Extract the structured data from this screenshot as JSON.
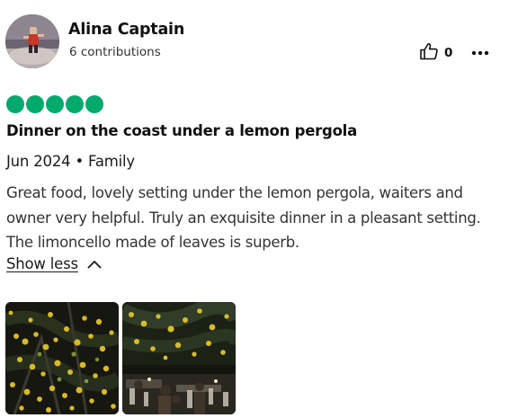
{
  "reviewer": {
    "name": "Alina Captain",
    "contributions": "6 contributions",
    "avatar_icon": "profile-photo-avatar"
  },
  "actions": {
    "helpful_icon": "thumbs-up-icon",
    "helpful_count": "0",
    "more_icon": "more-options-icon"
  },
  "rating": {
    "bubbles_filled": 5,
    "bubbles_total": 5,
    "color": "#00aa6c"
  },
  "review": {
    "title": "Dinner on the coast under a lemon pergola",
    "meta": "Jun 2024 • Family",
    "body": "Great food, lovely setting under the lemon pergola, waiters and owner very helpful. Truly an exquisite dinner in a pleasant setting. The limoncello made of leaves is superb.",
    "show_less_label": "Show less",
    "show_less_icon": "chevron-up-icon"
  },
  "photos": [
    {
      "subject": "lemon-pergola-photo"
    },
    {
      "subject": "restaurant-dining-photo"
    }
  ],
  "colors": {
    "text": "#1a1a1a",
    "accent": "#00aa6c"
  }
}
